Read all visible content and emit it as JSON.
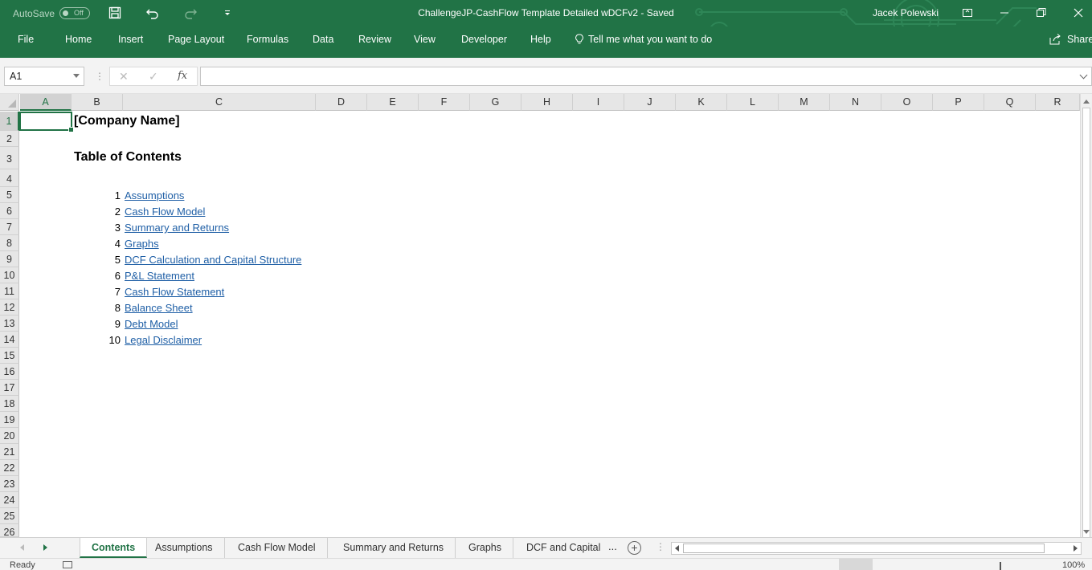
{
  "titlebar": {
    "autosave_label": "AutoSave",
    "autosave_state": "Off",
    "document_title": "ChallengeJP-CashFlow Template Detailed wDCFv2  -  Saved",
    "user_name": "Jacek Polewski"
  },
  "ribbon": {
    "tabs": [
      "File",
      "Home",
      "Insert",
      "Page Layout",
      "Formulas",
      "Data",
      "Review",
      "View",
      "Developer",
      "Help"
    ],
    "tell_me": "Tell me what you want to do",
    "share": "Share"
  },
  "formula_bar": {
    "name_box": "A1",
    "fx_label": "fx",
    "formula": ""
  },
  "grid": {
    "columns": [
      "A",
      "B",
      "C",
      "D",
      "E",
      "F",
      "G",
      "H",
      "I",
      "J",
      "K",
      "L",
      "M",
      "N",
      "O",
      "P",
      "Q",
      "R"
    ],
    "rows": [
      "1",
      "2",
      "3",
      "4",
      "5",
      "6",
      "7",
      "8",
      "9",
      "10",
      "11",
      "12",
      "13",
      "14",
      "15",
      "16",
      "17",
      "18",
      "19",
      "20",
      "21",
      "22",
      "23",
      "24",
      "25",
      "26"
    ],
    "selected_cell": "A1"
  },
  "sheet": {
    "company_name": "[Company Name]",
    "toc_title": "Table of Contents",
    "toc_items": [
      {
        "num": "1",
        "label": "Assumptions"
      },
      {
        "num": "2",
        "label": "Cash Flow Model"
      },
      {
        "num": "3",
        "label": "Summary and Returns"
      },
      {
        "num": "4",
        "label": "Graphs"
      },
      {
        "num": "5",
        "label": "DCF Calculation and Capital Structure"
      },
      {
        "num": "6",
        "label": "P&L Statement"
      },
      {
        "num": "7",
        "label": "Cash Flow Statement"
      },
      {
        "num": "8",
        "label": "Balance Sheet"
      },
      {
        "num": "9",
        "label": "Debt Model"
      },
      {
        "num": "10",
        "label": "Legal Disclaimer"
      }
    ]
  },
  "sheet_tabs": {
    "tabs": [
      "Contents",
      "Assumptions",
      "Cash Flow Model",
      "Summary and Returns",
      "Graphs",
      "DCF and Capital"
    ],
    "active": "Contents",
    "more": "..."
  },
  "statusbar": {
    "status": "Ready",
    "zoom": "100%"
  },
  "colors": {
    "accent": "#217346",
    "link": "#1f5fa6"
  }
}
